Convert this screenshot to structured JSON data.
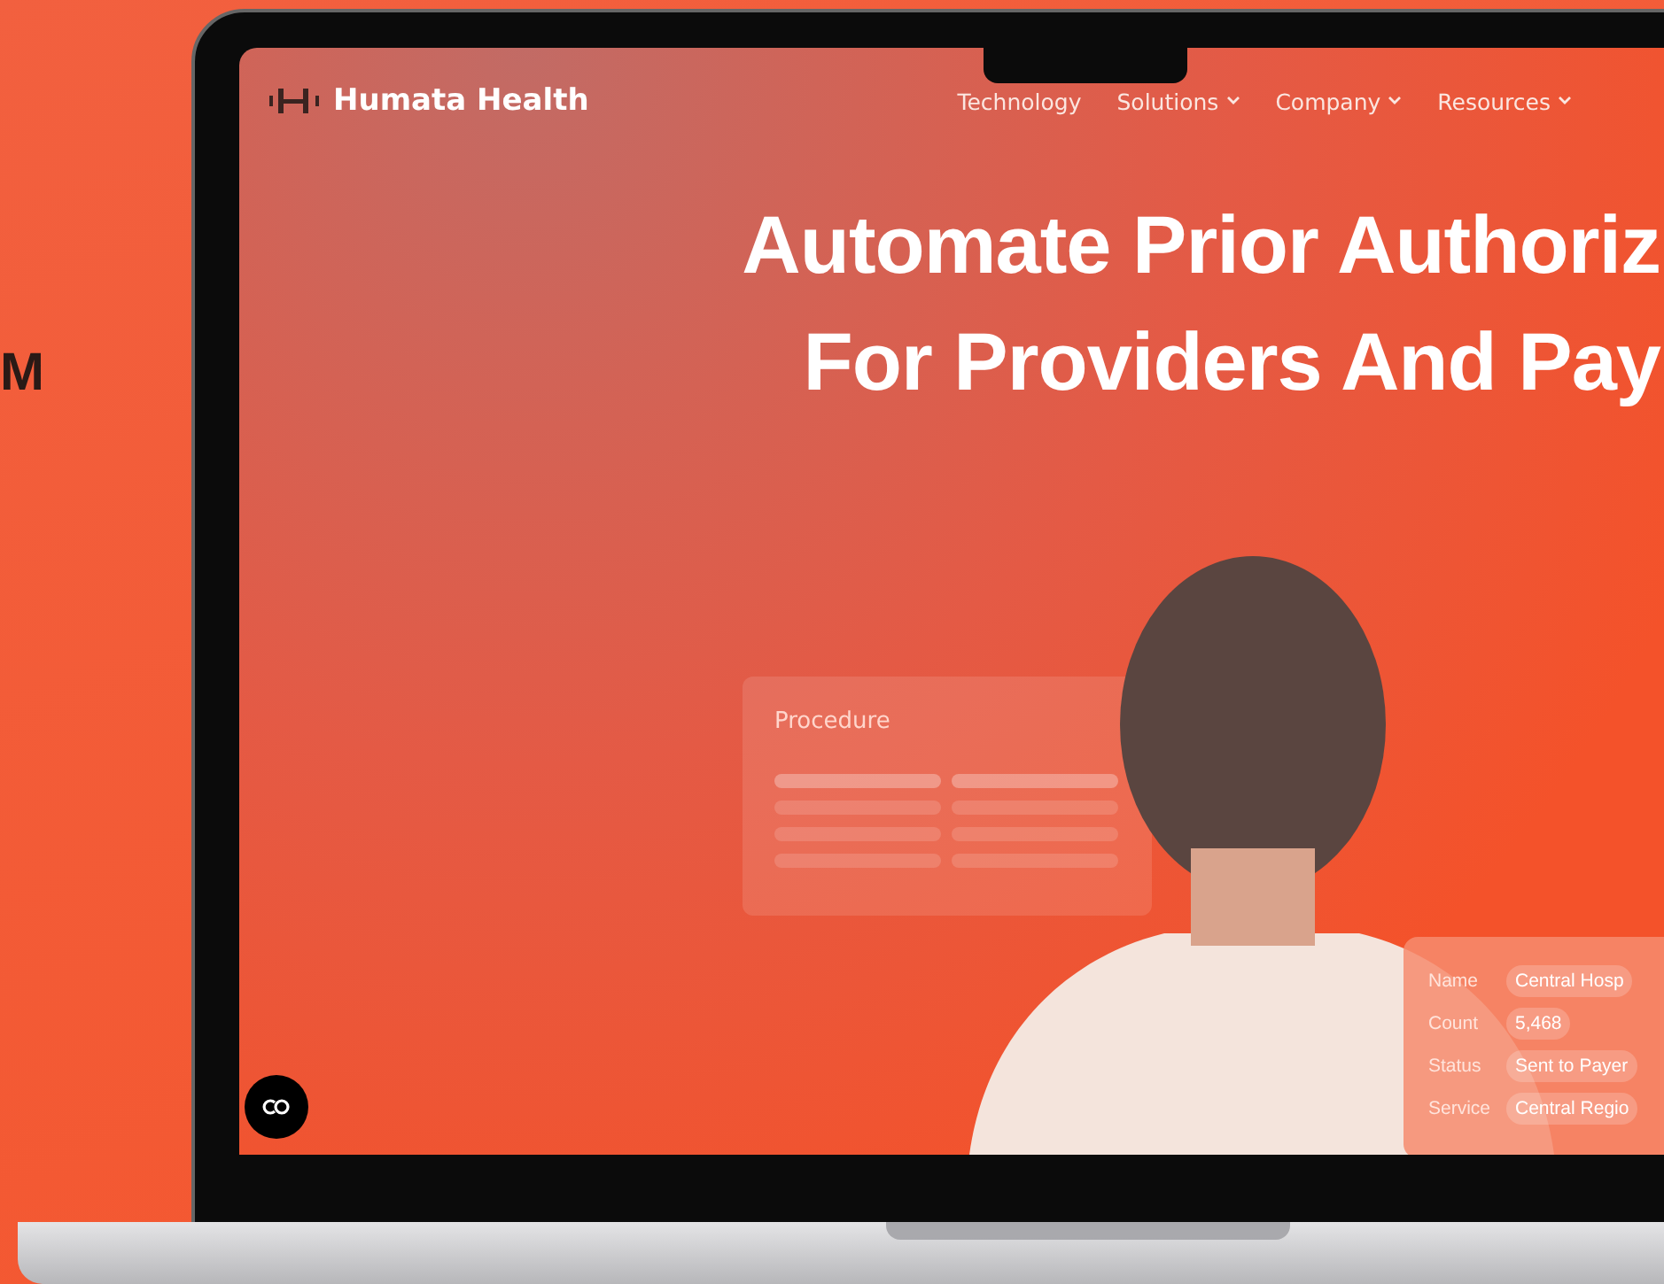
{
  "side_text": "M",
  "site": {
    "brand": "Humata Health",
    "nav": [
      {
        "label": "Technology",
        "has_menu": false
      },
      {
        "label": "Solutions",
        "has_menu": true
      },
      {
        "label": "Company",
        "has_menu": true
      },
      {
        "label": "Resources",
        "has_menu": true
      }
    ]
  },
  "hero": {
    "headline": [
      "Automate Prior Authoriz",
      "For Providers And Pay"
    ]
  },
  "procedure_card": {
    "title": "Procedure"
  },
  "record_card": {
    "rows": [
      {
        "label": "Name",
        "value": "Central Hosp"
      },
      {
        "label": "Count",
        "value": "5,468"
      },
      {
        "label": "Status",
        "value": "Sent to Payer"
      },
      {
        "label": "Service",
        "value": "Central Regio"
      }
    ]
  }
}
